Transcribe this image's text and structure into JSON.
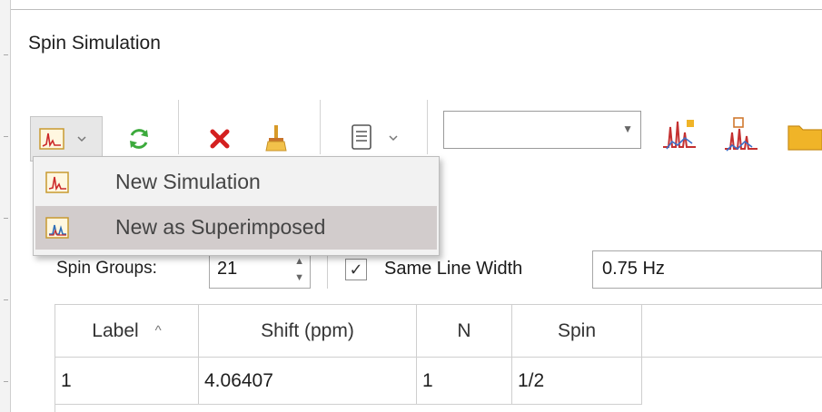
{
  "window": {
    "title": "Spin Simulation"
  },
  "toolbar": {
    "items": [
      {
        "name": "new-simulation-split-button",
        "icon": "spectrum-icon"
      },
      {
        "name": "refresh-button",
        "icon": "refresh-icon"
      },
      {
        "name": "delete-button",
        "icon": "close-icon"
      },
      {
        "name": "clear-button",
        "icon": "broom-icon"
      },
      {
        "name": "report-dropdown-button",
        "icon": "document-icon"
      },
      {
        "name": "spectrum-display-button",
        "icon": "spectrum-peaks-icon"
      },
      {
        "name": "spectrum-overlay-button",
        "icon": "multiplet-icon"
      },
      {
        "name": "open-folder-button",
        "icon": "folder-icon"
      }
    ],
    "combo": {
      "value": ""
    }
  },
  "dropdown_menu": {
    "items": [
      {
        "label": "New Simulation",
        "icon": "spectrum-icon"
      },
      {
        "label": "New as Superimposed",
        "icon": "superimposed-spectrum-icon",
        "highlighted": true
      }
    ]
  },
  "spin_groups": {
    "label": "Spin Groups:",
    "value": "21"
  },
  "same_line_width": {
    "label": "Same Line Width",
    "checked": true,
    "check_glyph": "✓",
    "value": "0.75 Hz"
  },
  "table": {
    "columns": [
      "Label",
      "Shift (ppm)",
      "N",
      "Spin"
    ],
    "sort_indicator": "^",
    "rows": [
      [
        "1",
        "4.06407",
        "1",
        "1/2"
      ]
    ]
  },
  "colors": {
    "highlight": "#d2cccc",
    "menu_bg": "#f2f2f2",
    "delete_red": "#d42020",
    "refresh_green": "#3caa3c",
    "folder_yellow": "#f0b428"
  }
}
